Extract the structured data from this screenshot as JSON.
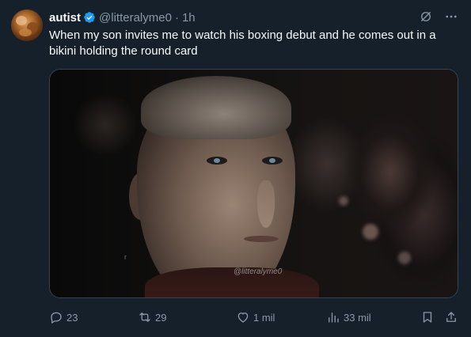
{
  "tweet": {
    "author_name": "autist",
    "verified": true,
    "handle": "@litteralyme0",
    "separator": "·",
    "time": "1h",
    "text": "When my son invites me to watch his boxing debut and he comes out in a bikini holding the round card",
    "media": {
      "watermark": "@litteralyme0",
      "watermark_fragment": "r"
    }
  },
  "actions": {
    "replies": "23",
    "reposts": "29",
    "likes": "1 mil",
    "views": "33 mil"
  },
  "colors": {
    "background": "#15202b",
    "text": "#f7f9f9",
    "muted": "#8b98a5",
    "verified": "#1d9bf0",
    "border": "#38444d"
  },
  "icons": {
    "verified": "verified-badge-icon",
    "grok": "grok-icon",
    "more": "more-icon",
    "reply": "reply-icon",
    "repost": "repost-icon",
    "like": "heart-icon",
    "views": "views-icon",
    "bookmark": "bookmark-icon",
    "share": "share-icon"
  }
}
